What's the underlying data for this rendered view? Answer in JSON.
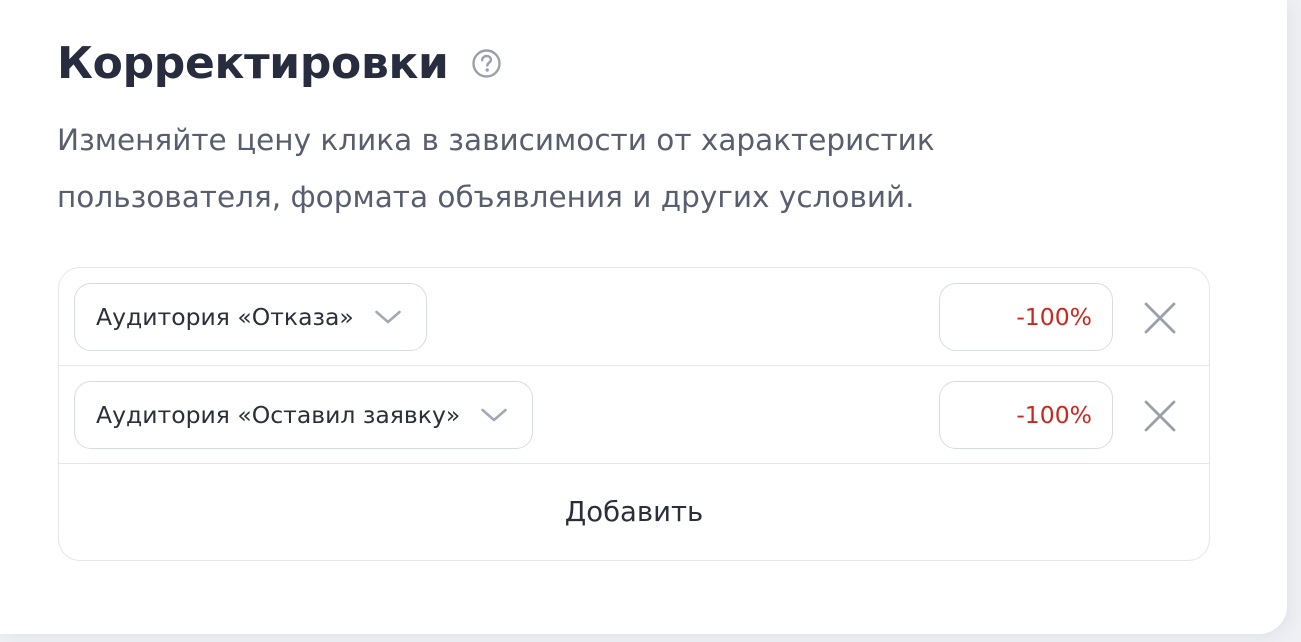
{
  "section": {
    "title": "Корректировки",
    "help_icon": "question-circle-icon",
    "description_lines": [
      "Изменяйте цену клика в зависимости от характеристик",
      "пользователя, формата объявления и других условий."
    ]
  },
  "adjustments": [
    {
      "audience": "Аудитория «Отказа»",
      "value": "-100%",
      "chevron_icon": "chevron-down-icon",
      "remove_icon": "close-icon"
    },
    {
      "audience": "Аудитория «Оставил заявку»",
      "value": "-100%",
      "chevron_icon": "chevron-down-icon",
      "remove_icon": "close-icon"
    }
  ],
  "add_button_label": "Добавить",
  "colors": {
    "title": "#272d3e",
    "text": "#585e6e",
    "negative_value": "#c8281e",
    "border": "#d7dbe3",
    "icon": "#9aa0ab"
  }
}
